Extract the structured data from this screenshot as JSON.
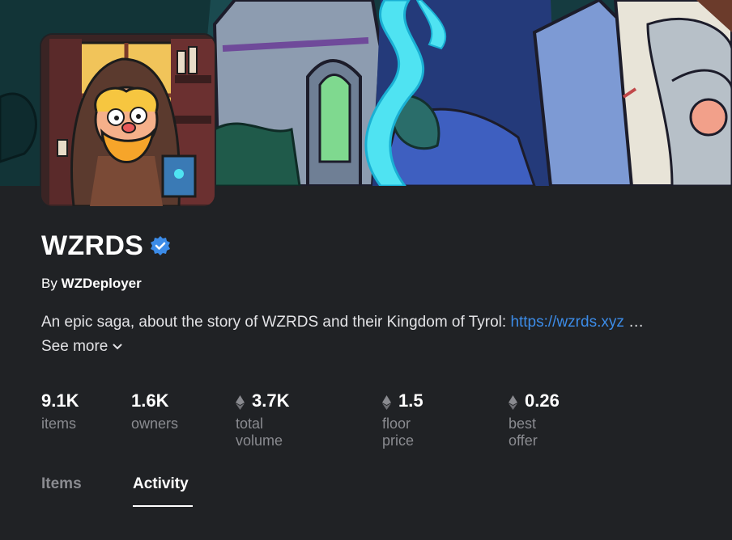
{
  "collection": {
    "name": "WZRDS",
    "verified_icon": "verified-badge-icon",
    "by_prefix": "By",
    "creator": "WZDeployer",
    "description_text": "An epic saga, about the story of WZRDS and their Kingdom of Tyrol: ",
    "description_link": "https://wzrds.xyz",
    "description_ellipsis": " …",
    "see_more_label": "See more",
    "accent_color": "#3c8ce8"
  },
  "stats": [
    {
      "value": "9.1K",
      "label": "items",
      "eth": false
    },
    {
      "value": "1.6K",
      "label": "owners",
      "eth": false
    },
    {
      "value": "3.7K",
      "label": "total volume",
      "eth": true
    },
    {
      "value": "1.5",
      "label": "floor price",
      "eth": true
    },
    {
      "value": "0.26",
      "label": "best offer",
      "eth": true
    }
  ],
  "tabs": [
    {
      "label": "Items",
      "active": false
    },
    {
      "label": "Activity",
      "active": true
    }
  ]
}
